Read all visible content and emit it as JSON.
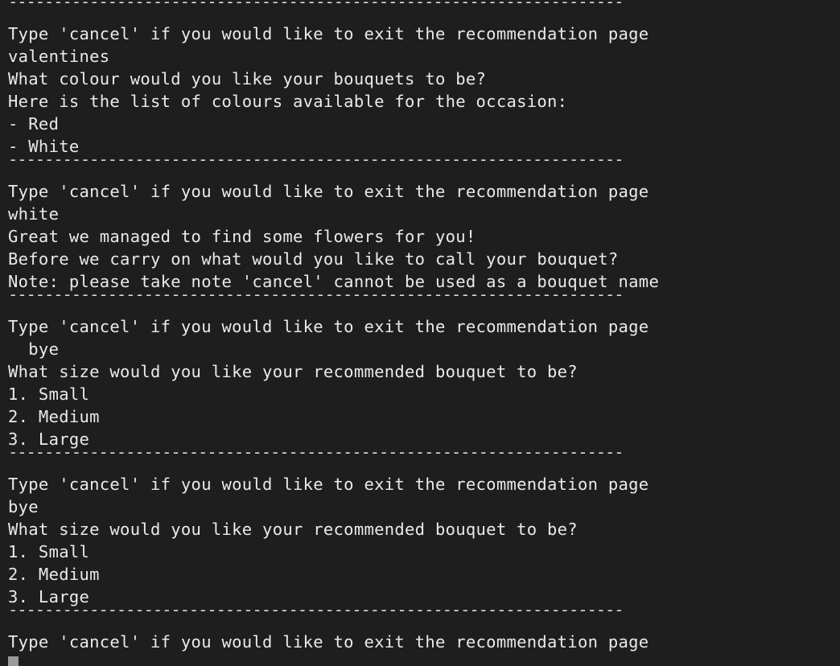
{
  "terminal": {
    "separator": "--------------------------------------------------------------------",
    "blocks": [
      {
        "prompt": "Type 'cancel' if you would like to exit the recommendation page",
        "input": "valentines",
        "output": [
          "What colour would you like your bouquets to be?",
          "Here is the list of colours available for the occasion:",
          "- Red",
          "- White",
          ""
        ]
      },
      {
        "prompt": "Type 'cancel' if you would like to exit the recommendation page",
        "input": "white",
        "output": [
          "Great we managed to find some flowers for you!",
          "Before we carry on what would you like to call your bouquet?",
          "Note: please take note 'cancel' cannot be used as a bouquet name"
        ]
      },
      {
        "prompt": "Type 'cancel' if you would like to exit the recommendation page",
        "input": "  bye",
        "output": [
          "What size would you like your recommended bouquet to be?",
          "1. Small",
          "2. Medium",
          "3. Large"
        ]
      },
      {
        "prompt": "Type 'cancel' if you would like to exit the recommendation page",
        "input": "bye",
        "output": [
          "What size would you like your recommended bouquet to be?",
          "1. Small",
          "2. Medium",
          "3. Large"
        ]
      },
      {
        "prompt": "Type 'cancel' if you would like to exit the recommendation page",
        "input": "",
        "output": []
      }
    ],
    "colors": {
      "background": "#1e1e1e",
      "text": "#eaeaea",
      "cursor": "#9a9a9a"
    }
  }
}
